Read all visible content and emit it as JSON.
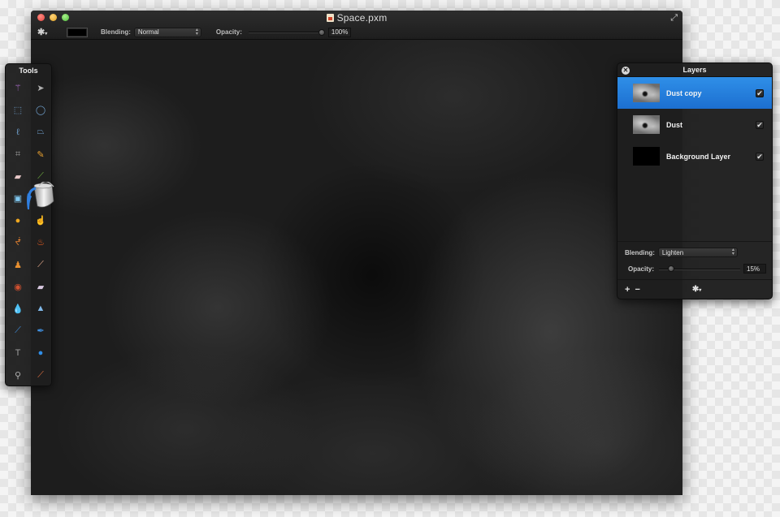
{
  "window": {
    "title": "Space.pxm",
    "traffic_lights": [
      "close",
      "minimize",
      "zoom"
    ]
  },
  "toolbar": {
    "gear_icon": "gear-icon",
    "color_swatch": "#000000",
    "blending_label": "Blending:",
    "blending_value": "Normal",
    "opacity_label": "Opacity:",
    "opacity_value": "100%",
    "opacity_fraction": 1.0
  },
  "tools_panel": {
    "title": "Tools",
    "tools": [
      {
        "name": "magic-wand-icon",
        "glyph": "⚚",
        "color": "#b070d0"
      },
      {
        "name": "move-icon",
        "glyph": "➤",
        "color": "#b0b0b0"
      },
      {
        "name": "rect-select-icon",
        "glyph": "⬚",
        "color": "#6d9cc8"
      },
      {
        "name": "ellipse-select-icon",
        "glyph": "◯",
        "color": "#6d9cc8"
      },
      {
        "name": "lasso-icon",
        "glyph": "ℓ",
        "color": "#6d9cc8"
      },
      {
        "name": "polygon-lasso-icon",
        "glyph": "⏢",
        "color": "#6d9cc8"
      },
      {
        "name": "crop-icon",
        "glyph": "⌗",
        "color": "#9a9a9a"
      },
      {
        "name": "pencil-icon",
        "glyph": "✎",
        "color": "#e8a030"
      },
      {
        "name": "eraser-icon",
        "glyph": "▰",
        "color": "#e8c8c8"
      },
      {
        "name": "brush-icon",
        "glyph": "⟋",
        "color": "#70b040"
      },
      {
        "name": "gradient-icon",
        "glyph": "▣",
        "color": "#80c8f0"
      },
      {
        "name": "paint-bucket-icon",
        "glyph": "",
        "color": "#c0c0c0"
      },
      {
        "name": "smudge-icon",
        "glyph": "●",
        "color": "#f0a820"
      },
      {
        "name": "retouch-icon",
        "glyph": "☝",
        "color": "#e0e0e0"
      },
      {
        "name": "burn-icon",
        "glyph": "ᖫ",
        "color": "#e08030"
      },
      {
        "name": "flame-icon",
        "glyph": "♨",
        "color": "#f06020"
      },
      {
        "name": "clone-stamp-icon",
        "glyph": "♟",
        "color": "#e89030"
      },
      {
        "name": "heal-icon",
        "glyph": "⟋",
        "color": "#f0b090"
      },
      {
        "name": "red-eye-icon",
        "glyph": "◉",
        "color": "#d05030"
      },
      {
        "name": "bg-eraser-icon",
        "glyph": "▰",
        "color": "#d8c8e0"
      },
      {
        "name": "blur-icon",
        "glyph": "💧",
        "color": "#70b0f0"
      },
      {
        "name": "sharpen-icon",
        "glyph": "▲",
        "color": "#80b8e8"
      },
      {
        "name": "pen-icon",
        "glyph": "⟋",
        "color": "#4090e0"
      },
      {
        "name": "freeform-pen-icon",
        "glyph": "✒",
        "color": "#4090e0"
      },
      {
        "name": "text-icon",
        "glyph": "T",
        "color": "#a0a0a0"
      },
      {
        "name": "shape-icon",
        "glyph": "●",
        "color": "#2f8ee8"
      },
      {
        "name": "zoom-icon",
        "glyph": "⚲",
        "color": "#b0b0b0"
      },
      {
        "name": "eyedropper-icon",
        "glyph": "⟋",
        "color": "#e07040"
      }
    ]
  },
  "layers_panel": {
    "title": "Layers",
    "layers": [
      {
        "name": "Dust copy",
        "visible": true,
        "selected": true,
        "thumb": "dust"
      },
      {
        "name": "Dust",
        "visible": true,
        "selected": false,
        "thumb": "dust"
      },
      {
        "name": "Background Layer",
        "visible": true,
        "selected": false,
        "thumb": "bg"
      }
    ],
    "blending_label": "Blending:",
    "blending_value": "Lighten",
    "opacity_label": "Opacity:",
    "opacity_value": "15%",
    "opacity_fraction": 0.15,
    "add_label": "+",
    "remove_label": "−",
    "check_glyph": "✔"
  }
}
